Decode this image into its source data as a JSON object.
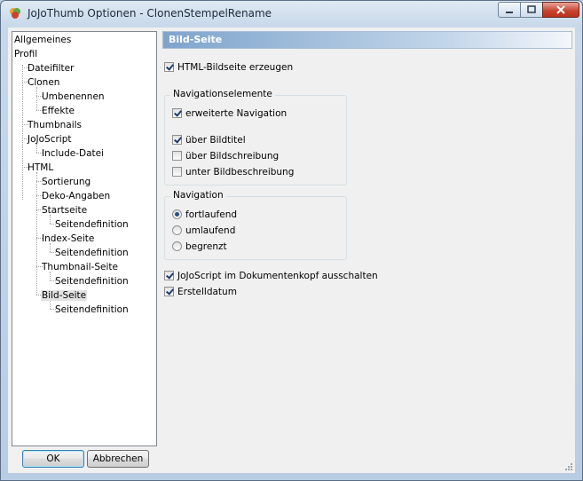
{
  "window": {
    "title": "JoJoThumb Optionen - ClonenStempelRename"
  },
  "tree": {
    "items": [
      {
        "label": "Allgemeines",
        "level": 0
      },
      {
        "label": "Profil",
        "level": 0
      },
      {
        "label": "Dateifilter",
        "level": 1
      },
      {
        "label": "Clonen",
        "level": 1
      },
      {
        "label": "Umbenennen",
        "level": 2
      },
      {
        "label": "Effekte",
        "level": 2
      },
      {
        "label": "Thumbnails",
        "level": 1
      },
      {
        "label": "JoJoScript",
        "level": 1
      },
      {
        "label": "Include-Datei",
        "level": 2
      },
      {
        "label": "HTML",
        "level": 1
      },
      {
        "label": "Sortierung",
        "level": 2
      },
      {
        "label": "Deko-Angaben",
        "level": 2
      },
      {
        "label": "Startseite",
        "level": 2
      },
      {
        "label": "Seitendefinition",
        "level": 3
      },
      {
        "label": "Index-Seite",
        "level": 2
      },
      {
        "label": "Seitendefinition",
        "level": 3
      },
      {
        "label": "Thumbnail-Seite",
        "level": 2
      },
      {
        "label": "Seitendefinition",
        "level": 3
      },
      {
        "label": "Bild-Seite",
        "level": 2,
        "selected": true
      },
      {
        "label": "Seitendefinition",
        "level": 3
      }
    ]
  },
  "panel": {
    "header": "Bild-Seite",
    "html_bildseite": {
      "label": "HTML-Bildseite erzeugen",
      "checked": true
    },
    "nav_elements": {
      "title": "Navigationselemente",
      "erweitert": {
        "label": "erweiterte Navigation",
        "checked": true
      },
      "ueber_bildtitel": {
        "label": "über Bildtitel",
        "checked": true
      },
      "ueber_bildschreibung": {
        "label": "über Bildschreibung",
        "checked": false
      },
      "unter_bildbeschreibung": {
        "label": "unter Bildbeschreibung",
        "checked": false
      }
    },
    "navigation": {
      "title": "Navigation",
      "options": [
        {
          "label": "fortlaufend",
          "selected": true
        },
        {
          "label": "umlaufend",
          "selected": false
        },
        {
          "label": "begrenzt",
          "selected": false
        }
      ]
    },
    "jojoscript_off": {
      "label": "JoJoScript im Dokumentenkopf ausschalten",
      "checked": true
    },
    "erstelldatum": {
      "label": "Erstelldatum",
      "checked": true
    }
  },
  "buttons": {
    "ok": "OK",
    "cancel": "Abbrechen"
  }
}
